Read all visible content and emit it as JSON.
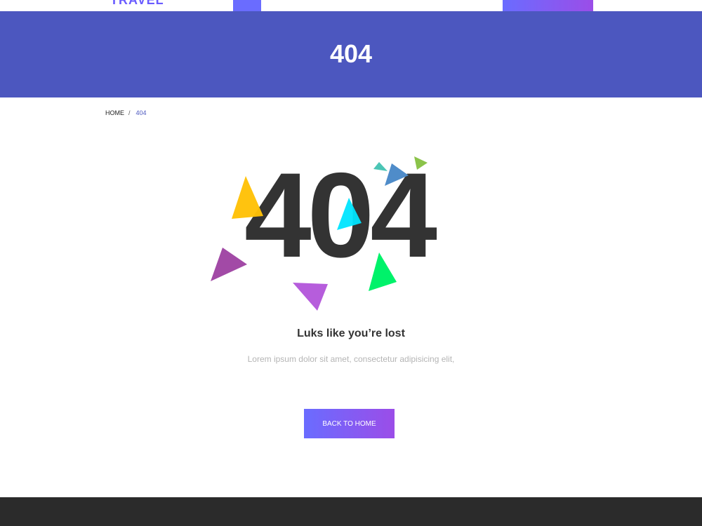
{
  "header": {
    "logo_text": "TRAVEL"
  },
  "banner": {
    "title": "404"
  },
  "breadcrumb": {
    "home": "HOME",
    "separator": "/",
    "current": "404"
  },
  "error": {
    "code": "404",
    "heading": "Luks like you’re lost",
    "text": "Lorem ipsum dolor sit amet, consectetur adipisicing elit,",
    "button_label": "BACK TO HOME"
  },
  "colors": {
    "banner": "#4c57bf",
    "accent_start": "#6a6cff",
    "accent_end": "#9b4de8",
    "footer": "#2b2b2b",
    "dark_text": "#333333"
  }
}
